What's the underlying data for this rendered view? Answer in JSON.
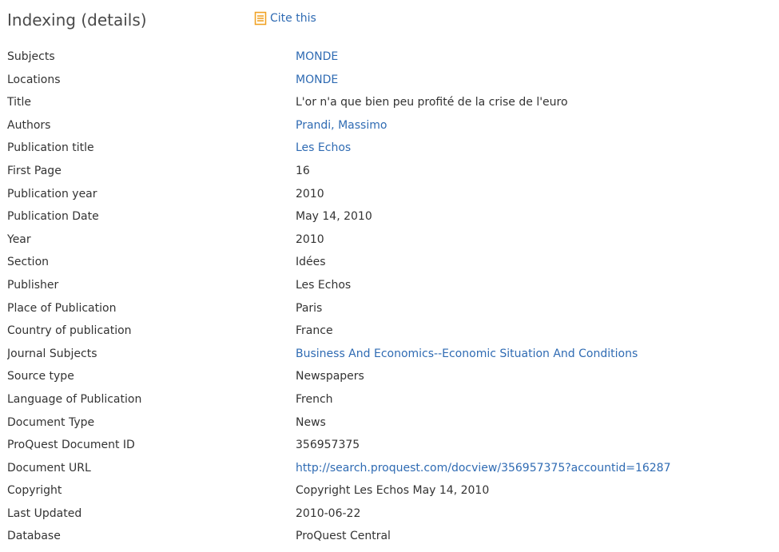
{
  "header": {
    "title": "Indexing (details)",
    "cite_label": "Cite this",
    "cite_icon": "document-list-icon",
    "accent_color": "#f0a020",
    "link_color": "#2f6bb3"
  },
  "rows": [
    {
      "label": "Subjects",
      "value": "MONDE"
    },
    {
      "label": "Locations",
      "value": "MONDE"
    },
    {
      "label": "Title",
      "value": "L'or n'a que bien peu profité de la crise de l'euro"
    },
    {
      "label": "Authors",
      "value": "Prandi, Massimo"
    },
    {
      "label": "Publication title",
      "value": "Les Echos"
    },
    {
      "label": "First Page",
      "value": "16"
    },
    {
      "label": "Publication year",
      "value": "2010"
    },
    {
      "label": "Publication Date",
      "value": "May 14, 2010"
    },
    {
      "label": "Year",
      "value": "2010"
    },
    {
      "label": "Section",
      "value": "Idées"
    },
    {
      "label": "Publisher",
      "value": "Les Echos"
    },
    {
      "label": "Place of Publication",
      "value": "Paris"
    },
    {
      "label": "Country of publication",
      "value": "France"
    },
    {
      "label": "Journal Subjects",
      "value": "Business And Economics--Economic Situation And Conditions"
    },
    {
      "label": "Source type",
      "value": "Newspapers"
    },
    {
      "label": "Language of Publication",
      "value": "French"
    },
    {
      "label": "Document Type",
      "value": "News"
    },
    {
      "label": "ProQuest Document ID",
      "value": "356957375"
    },
    {
      "label": "Document URL",
      "value": "http://search.proquest.com/docview/356957375?accountid=16287"
    },
    {
      "label": "Copyright",
      "value": "Copyright Les Echos May 14, 2010"
    },
    {
      "label": "Last Updated",
      "value": "2010-06-22"
    },
    {
      "label": "Database",
      "value": "ProQuest Central"
    }
  ]
}
